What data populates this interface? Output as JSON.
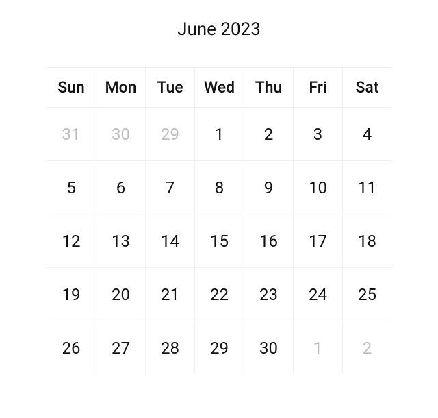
{
  "calendar": {
    "title": "June 2023",
    "weekdays": [
      "Sun",
      "Mon",
      "Tue",
      "Wed",
      "Thu",
      "Fri",
      "Sat"
    ],
    "days": [
      {
        "label": "31",
        "muted": true
      },
      {
        "label": "30",
        "muted": true
      },
      {
        "label": "29",
        "muted": true
      },
      {
        "label": "1",
        "muted": false
      },
      {
        "label": "2",
        "muted": false
      },
      {
        "label": "3",
        "muted": false
      },
      {
        "label": "4",
        "muted": false
      },
      {
        "label": "5",
        "muted": false
      },
      {
        "label": "6",
        "muted": false
      },
      {
        "label": "7",
        "muted": false
      },
      {
        "label": "8",
        "muted": false
      },
      {
        "label": "9",
        "muted": false
      },
      {
        "label": "10",
        "muted": false
      },
      {
        "label": "11",
        "muted": false
      },
      {
        "label": "12",
        "muted": false
      },
      {
        "label": "13",
        "muted": false
      },
      {
        "label": "14",
        "muted": false
      },
      {
        "label": "15",
        "muted": false
      },
      {
        "label": "16",
        "muted": false
      },
      {
        "label": "17",
        "muted": false
      },
      {
        "label": "18",
        "muted": false
      },
      {
        "label": "19",
        "muted": false
      },
      {
        "label": "20",
        "muted": false
      },
      {
        "label": "21",
        "muted": false
      },
      {
        "label": "22",
        "muted": false
      },
      {
        "label": "23",
        "muted": false
      },
      {
        "label": "24",
        "muted": false
      },
      {
        "label": "25",
        "muted": false
      },
      {
        "label": "26",
        "muted": false
      },
      {
        "label": "27",
        "muted": false
      },
      {
        "label": "28",
        "muted": false
      },
      {
        "label": "29",
        "muted": false
      },
      {
        "label": "30",
        "muted": false
      },
      {
        "label": "1",
        "muted": true
      },
      {
        "label": "2",
        "muted": true
      }
    ]
  }
}
